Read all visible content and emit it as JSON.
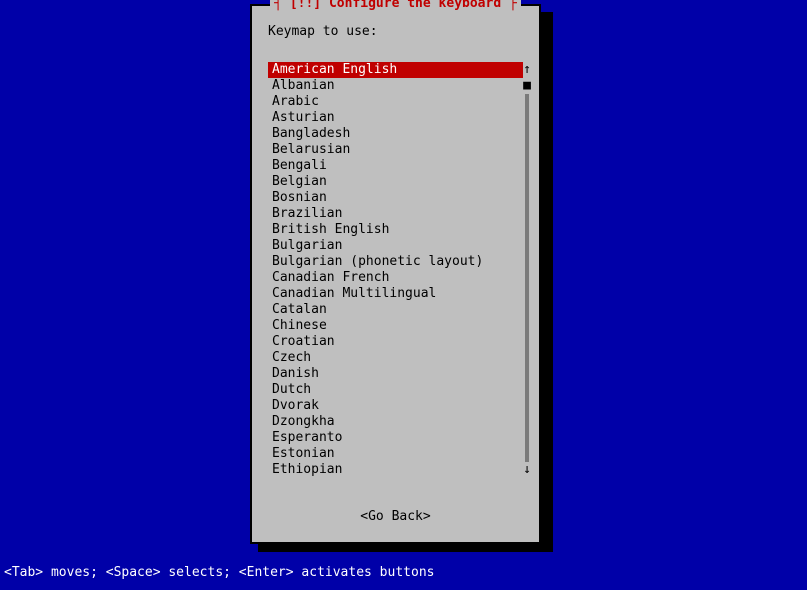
{
  "dialog": {
    "title_prefix": "┤ ",
    "title_marker": "[!!]",
    "title_text": " Configure the keyboard ",
    "title_suffix": "├",
    "prompt": "Keymap to use:"
  },
  "list": {
    "selected_index": 0,
    "items": [
      "American English",
      "Albanian",
      "Arabic",
      "Asturian",
      "Bangladesh",
      "Belarusian",
      "Bengali",
      "Belgian",
      "Bosnian",
      "Brazilian",
      "British English",
      "Bulgarian",
      "Bulgarian (phonetic layout)",
      "Canadian French",
      "Canadian Multilingual",
      "Catalan",
      "Chinese",
      "Croatian",
      "Czech",
      "Danish",
      "Dutch",
      "Dvorak",
      "Dzongkha",
      "Esperanto",
      "Estonian",
      "Ethiopian"
    ]
  },
  "scroll": {
    "up_arrow": "↑",
    "thumb": "■",
    "down_arrow": "↓"
  },
  "go_back": "<Go Back>",
  "footer": "<Tab> moves; <Space> selects; <Enter> activates buttons"
}
